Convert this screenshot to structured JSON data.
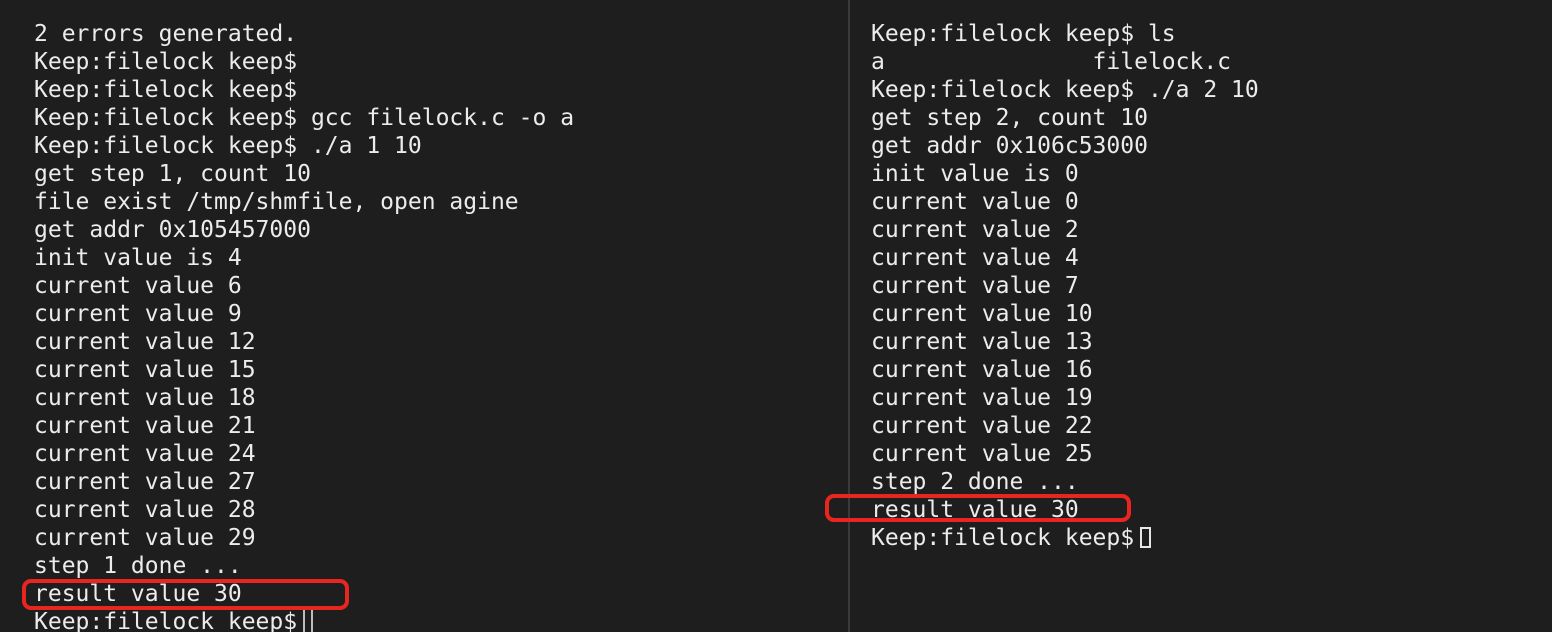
{
  "left_terminal": {
    "lines": [
      "2 errors generated.",
      "Keep:filelock keep$",
      "Keep:filelock keep$",
      "Keep:filelock keep$ gcc filelock.c -o a",
      "Keep:filelock keep$ ./a 1 10",
      "get step 1, count 10",
      "file exist /tmp/shmfile, open agine",
      "get addr 0x105457000",
      "init value is 4",
      "current value 6",
      "current value 9",
      "current value 12",
      "current value 15",
      "current value 18",
      "current value 21",
      "current value 24",
      "current value 27",
      "current value 28",
      "current value 29",
      "step 1 done ...",
      "result value 30"
    ],
    "prompt": "Keep:filelock keep$"
  },
  "right_terminal": {
    "lines": [
      "Keep:filelock keep$ ls",
      "a               filelock.c",
      "Keep:filelock keep$ ./a 2 10",
      "get step 2, count 10",
      "get addr 0x106c53000",
      "init value is 0",
      "current value 0",
      "current value 2",
      "current value 4",
      "current value 7",
      "current value 10",
      "current value 13",
      "current value 16",
      "current value 19",
      "current value 22",
      "current value 25",
      "step 2 done ...",
      "result value 30"
    ],
    "prompt": "Keep:filelock keep$"
  },
  "colors": {
    "background": "#1e1e1e",
    "text": "#ececec",
    "highlight_box": "#e8261f",
    "divider": "#3a3a3a"
  }
}
